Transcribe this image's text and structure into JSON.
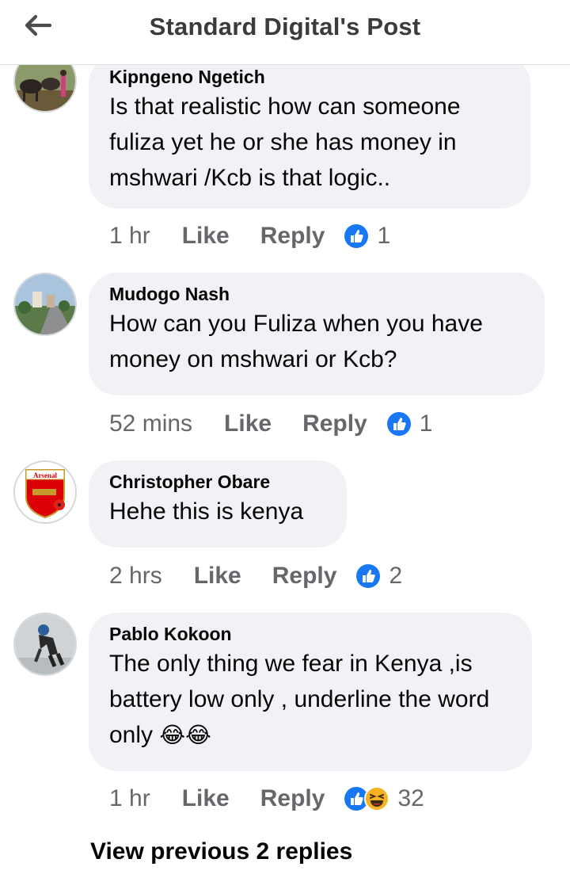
{
  "header": {
    "title": "Standard Digital's Post"
  },
  "comments": [
    {
      "author": "Kipngeno Ngetich",
      "text": "Is that realistic how can someone fuliza yet he or she has money in mshwari /Kcb is that logic..",
      "time": "1 hr",
      "like": "Like",
      "reply": "Reply",
      "reaction_count": "1",
      "avatar_icon": "cattle-photo-avatar"
    },
    {
      "author": "Mudogo Nash",
      "text": "How can you Fuliza when you have money on mshwari or Kcb?",
      "time": "52 mins",
      "like": "Like",
      "reply": "Reply",
      "reaction_count": "1",
      "avatar_icon": "city-road-photo-avatar"
    },
    {
      "author": "Christopher Obare",
      "text": "Hehe this is kenya",
      "time": "2 hrs",
      "like": "Like",
      "reply": "Reply",
      "reaction_count": "2",
      "avatar_icon": "arsenal-crest-avatar",
      "avatar_text": "Arsenal"
    },
    {
      "author": "Pablo Kokoon",
      "text": "The only thing we fear in Kenya ,is battery low only , underline the word only",
      "emoji": "😂😂",
      "time": "1 hr",
      "like": "Like",
      "reply": "Reply",
      "reaction_count": "32",
      "avatar_icon": "person-crouching-avatar"
    }
  ],
  "footer": {
    "view_previous": "View previous 2 replies"
  },
  "colors": {
    "like_blue": "#1877f2",
    "bubble_bg": "#f0f2f5",
    "meta_gray": "#65676b",
    "haha_yellow": "#f7b125"
  }
}
